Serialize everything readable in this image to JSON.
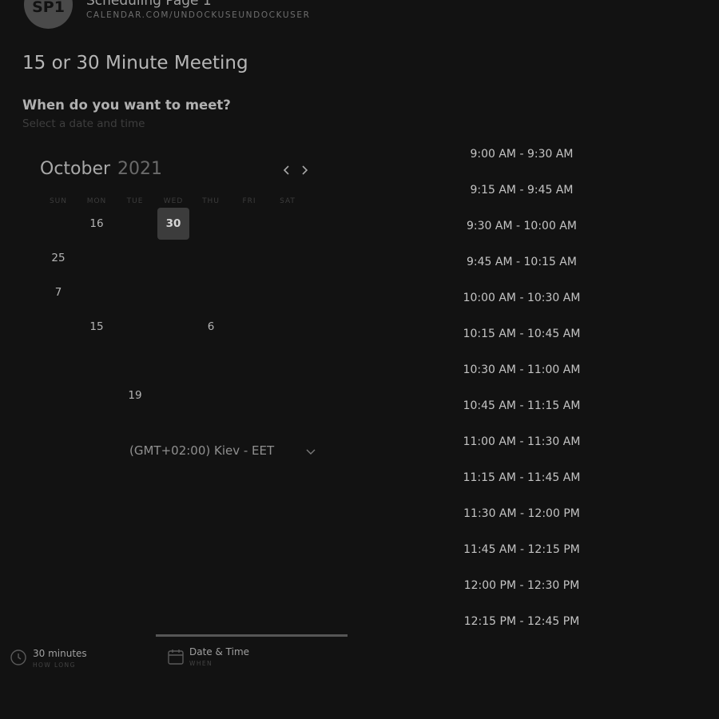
{
  "header": {
    "avatar_text": "SP1",
    "page_name": "Scheduling Page 1",
    "page_url": "CALENDAR.COM/UNDOCKUSEUNDOCKUSER"
  },
  "meeting": {
    "title": "15 or 30 Minute Meeting"
  },
  "question": {
    "heading": "When do you want to meet?",
    "subtext": "Select a date and time"
  },
  "calendar": {
    "month": "October",
    "year": "2021",
    "weekdays": [
      "SUN",
      "MON",
      "TUE",
      "WED",
      "THU",
      "FRI",
      "SAT"
    ],
    "days": [
      "16",
      "30",
      "25",
      "7",
      "15",
      "6",
      "19"
    ],
    "selected": "30"
  },
  "timezone": {
    "label": "(GMT+02:00) Kiev - EET"
  },
  "time_slots": [
    "9:00 AM - 9:30 AM",
    "9:15 AM - 9:45 AM",
    "9:30 AM - 10:00 AM",
    "9:45 AM - 10:15 AM",
    "10:00 AM - 10:30 AM",
    "10:15 AM - 10:45 AM",
    "10:30 AM - 11:00 AM",
    "10:45 AM - 11:15 AM",
    "11:00 AM - 11:30 AM",
    "11:15 AM - 11:45 AM",
    "11:30 AM - 12:00 PM",
    "11:45 AM - 12:15 PM",
    "12:00 PM - 12:30 PM",
    "12:15 PM - 12:45 PM"
  ],
  "steps": [
    {
      "title": "30 minutes",
      "subtitle": "HOW LONG",
      "icon": "clock-icon"
    },
    {
      "title": "Date & Time",
      "subtitle": "WHEN",
      "icon": "calendar-icon"
    }
  ]
}
